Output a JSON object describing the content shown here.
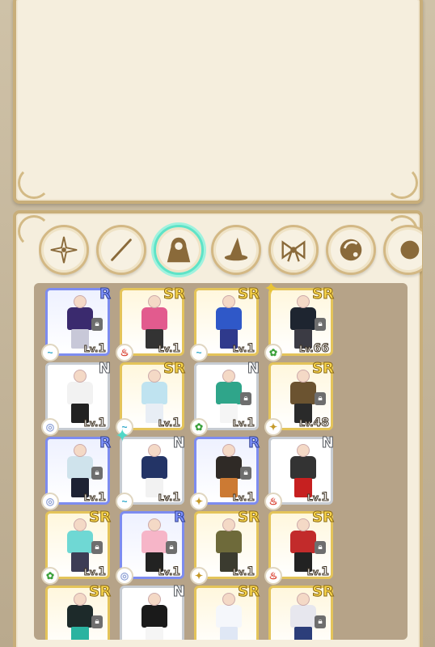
{
  "tabs": [
    {
      "name": "tab-all",
      "icon": "compass-star-icon"
    },
    {
      "name": "tab-weapon",
      "icon": "wand-icon"
    },
    {
      "name": "tab-outfit",
      "icon": "cloak-icon",
      "active": true
    },
    {
      "name": "tab-hat",
      "icon": "witch-hat-icon"
    },
    {
      "name": "tab-accessory",
      "icon": "bow-icon"
    },
    {
      "name": "tab-orb",
      "icon": "orb-icon"
    },
    {
      "name": "tab-more",
      "icon": "partial-icon"
    }
  ],
  "level_prefix": "Lv.",
  "items": [
    {
      "rarity": "R",
      "level": "1",
      "locked": true,
      "element": "wind",
      "colors": [
        "#3a2a6e",
        "#c8c8d8"
      ]
    },
    {
      "rarity": "SR",
      "level": "1",
      "locked": false,
      "element": "fire",
      "colors": [
        "#e25b8e",
        "#333333"
      ]
    },
    {
      "rarity": "SR",
      "level": "1",
      "locked": false,
      "element": "wind",
      "colors": [
        "#2f58c8",
        "#2f3a8c"
      ]
    },
    {
      "rarity": "SR",
      "level": "66",
      "locked": true,
      "element": "leaf",
      "colors": [
        "#1e2530",
        "#3b3b44"
      ]
    },
    {
      "rarity": "N",
      "level": "1",
      "locked": false,
      "element": "ice",
      "colors": [
        "#f2f2f2",
        "#222222"
      ]
    },
    {
      "rarity": "SR",
      "level": "1",
      "locked": false,
      "element": "wind",
      "colors": [
        "#bfe3f0",
        "#e8eef5"
      ]
    },
    {
      "rarity": "N",
      "level": "1",
      "locked": true,
      "element": "leaf",
      "colors": [
        "#2fa58a",
        "#f5f5f5"
      ]
    },
    {
      "rarity": "SR",
      "level": "48",
      "locked": true,
      "element": "earth",
      "colors": [
        "#6b5330",
        "#2a2a2a"
      ]
    },
    {
      "rarity": "R",
      "level": "1",
      "locked": true,
      "element": "ice",
      "colors": [
        "#cfe3ec",
        "#1e2233"
      ]
    },
    {
      "rarity": "N",
      "level": "1",
      "locked": false,
      "element": "wind",
      "colors": [
        "#233466",
        "#f2f2f2"
      ]
    },
    {
      "rarity": "R",
      "level": "1",
      "locked": true,
      "element": "earth",
      "colors": [
        "#2f2a26",
        "#cc7a33"
      ]
    },
    {
      "rarity": "N",
      "level": "1",
      "locked": false,
      "element": "fire",
      "colors": [
        "#333333",
        "#c62020"
      ]
    },
    {
      "rarity": "SR",
      "level": "1",
      "locked": true,
      "element": "leaf",
      "colors": [
        "#6fd8d4",
        "#3c3c55"
      ]
    },
    {
      "rarity": "R",
      "level": "1",
      "locked": true,
      "element": "ice",
      "colors": [
        "#f6b5c8",
        "#222222"
      ]
    },
    {
      "rarity": "SR",
      "level": "1",
      "locked": false,
      "element": "earth",
      "colors": [
        "#6e6a3a",
        "#3b3b2f"
      ]
    },
    {
      "rarity": "SR",
      "level": "1",
      "locked": true,
      "element": "fire",
      "colors": [
        "#c22b2b",
        "#222222"
      ]
    },
    {
      "rarity": "SR",
      "level": "",
      "locked": true,
      "element": "leaf",
      "colors": [
        "#1d2a2a",
        "#2ab3a0"
      ]
    },
    {
      "rarity": "N",
      "level": "",
      "locked": false,
      "element": "ice",
      "colors": [
        "#1a1a1a",
        "#f5f5f5"
      ]
    },
    {
      "rarity": "SR",
      "level": "",
      "locked": false,
      "element": "wind",
      "colors": [
        "#f5f7fb",
        "#dfe7f5"
      ]
    },
    {
      "rarity": "SR",
      "level": "",
      "locked": true,
      "element": "ice",
      "colors": [
        "#e7e7ee",
        "#2c3e7a"
      ]
    }
  ],
  "element_colors": {
    "wind": "#2aa6c8",
    "fire": "#d83a2a",
    "leaf": "#3aa03a",
    "ice": "#8fa2d6",
    "earth": "#c69a2a"
  },
  "element_glyphs": {
    "wind": "~",
    "fire": "♨",
    "leaf": "✿",
    "ice": "◎",
    "earth": "✦"
  }
}
